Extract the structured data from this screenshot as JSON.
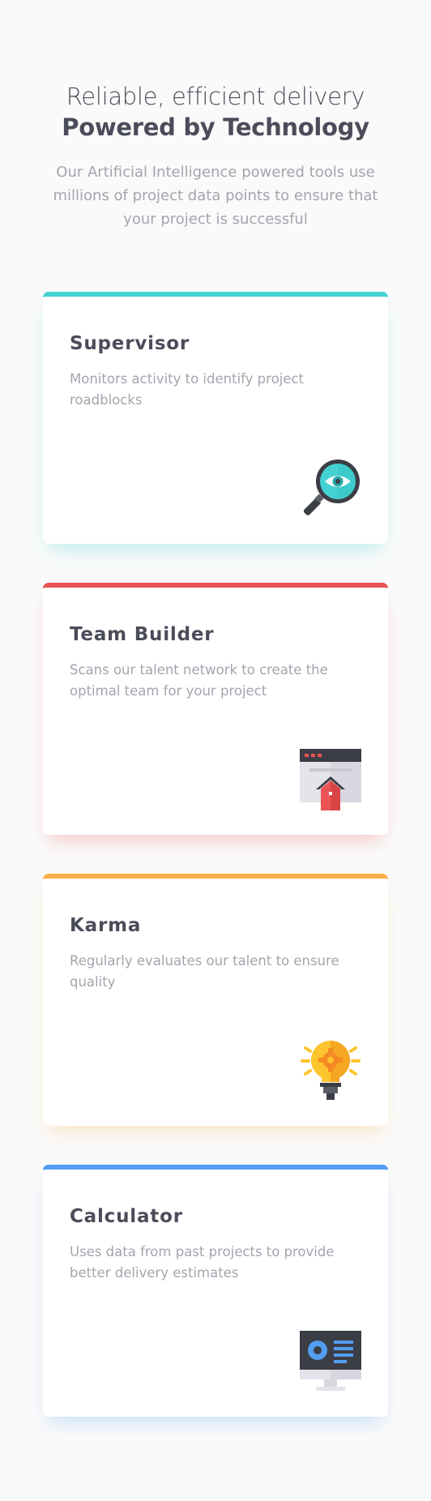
{
  "header": {
    "line1": "Reliable, efficient delivery",
    "line2": "Powered by Technology",
    "subtitle": "Our Artificial Intelligence powered tools use millions of project data points to ensure that your project is successful"
  },
  "cards": [
    {
      "title": "Supervisor",
      "description": "Monitors activity to identify project roadblocks",
      "icon": "magnifier-eye-icon",
      "accent": "#44d3d2"
    },
    {
      "title": "Team Builder",
      "description": "Scans our talent network to create the optimal team for your project",
      "icon": "browser-house-icon",
      "accent": "#ea5454"
    },
    {
      "title": "Karma",
      "description": "Regularly evaluates our talent to ensure quality",
      "icon": "lightbulb-icon",
      "accent": "#fcaf4a"
    },
    {
      "title": "Calculator",
      "description": "Uses data from past projects to provide better delivery estimates",
      "icon": "computer-monitor-icon",
      "accent": "#549ef2"
    }
  ]
}
